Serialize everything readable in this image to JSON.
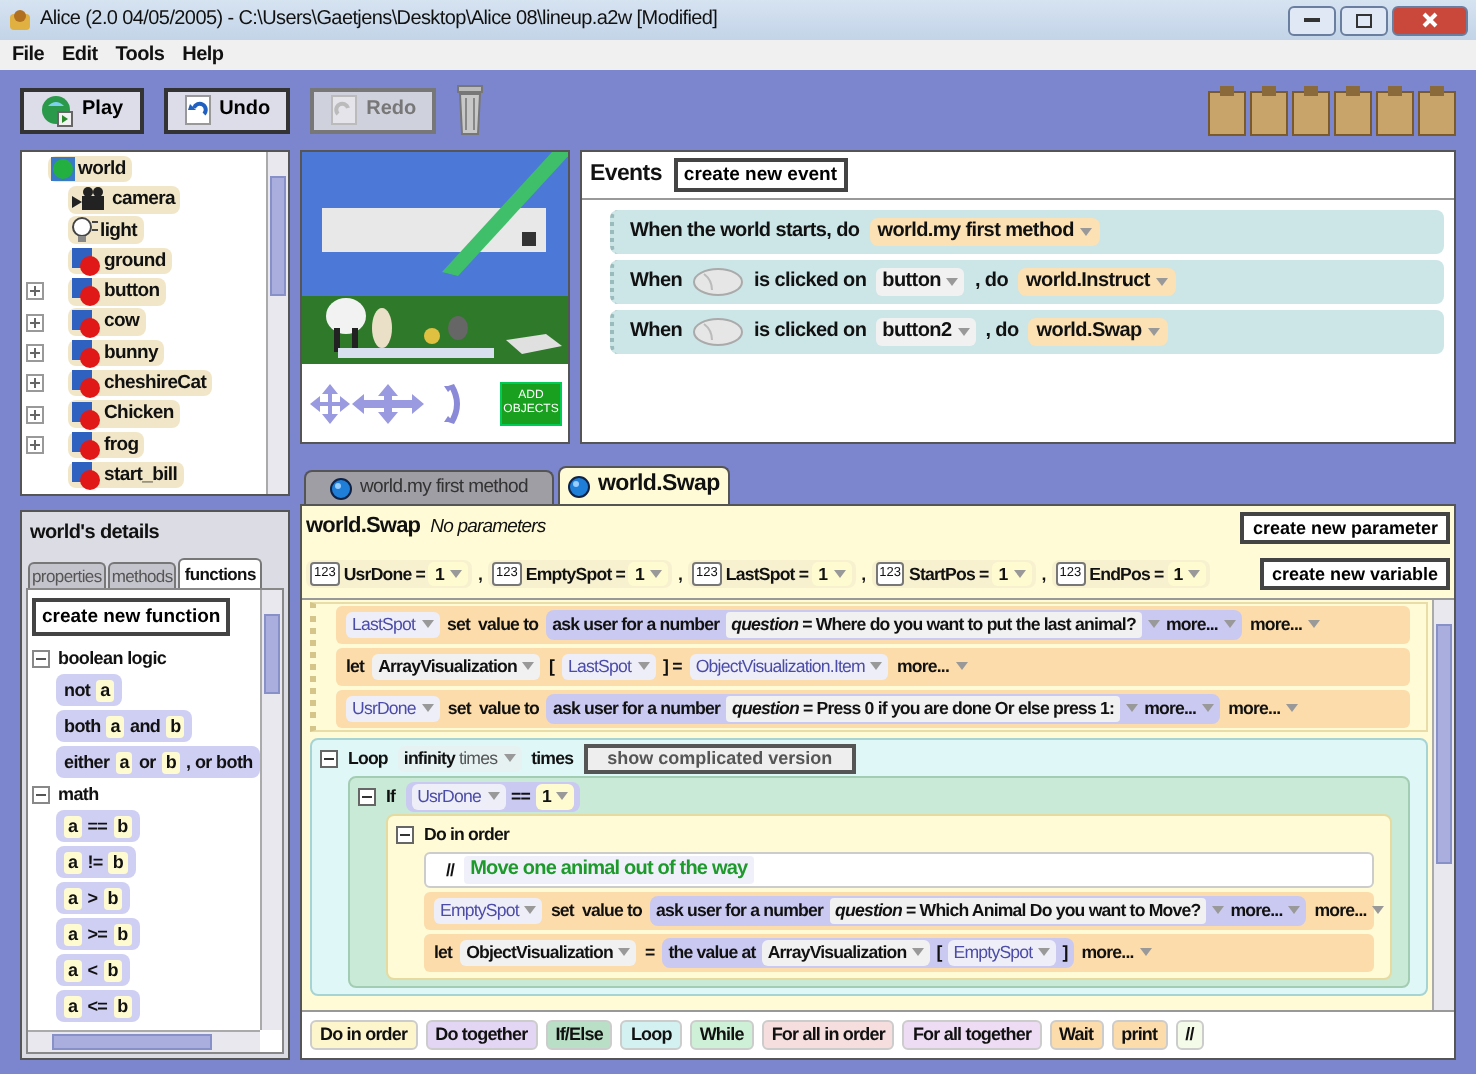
{
  "window": {
    "title": "Alice (2.0 04/05/2005) - C:\\Users\\Gaetjens\\Desktop\\Alice 08\\lineup.a2w [Modified]"
  },
  "menu": [
    "File",
    "Edit",
    "Tools",
    "Help"
  ],
  "toolbar": [
    {
      "label": "Play",
      "kind": "play",
      "disabled": false
    },
    {
      "label": "Undo",
      "kind": "undo",
      "disabled": false
    },
    {
      "label": "Redo",
      "kind": "redo",
      "disabled": true
    }
  ],
  "object_tree": {
    "root": "world",
    "items": [
      {
        "label": "camera",
        "kind": "camera",
        "expandable": false
      },
      {
        "label": "light",
        "kind": "light",
        "expandable": false
      },
      {
        "label": "ground",
        "kind": "object",
        "expandable": false
      },
      {
        "label": "button",
        "kind": "object",
        "expandable": true
      },
      {
        "label": "cow",
        "kind": "object",
        "expandable": true
      },
      {
        "label": "bunny",
        "kind": "object",
        "expandable": true
      },
      {
        "label": "cheshireCat",
        "kind": "object",
        "expandable": true
      },
      {
        "label": "Chicken",
        "kind": "object",
        "expandable": true
      },
      {
        "label": "frog",
        "kind": "object",
        "expandable": true
      },
      {
        "label": "start_bill",
        "kind": "object",
        "expandable": false
      }
    ]
  },
  "scene": {
    "kind": "picture",
    "add_button": "ADD OBJECTS"
  },
  "details": {
    "title": "world's details",
    "tabs": [
      {
        "label": "properties",
        "selected": false
      },
      {
        "label": "methods",
        "selected": false
      },
      {
        "label": "functions",
        "selected": true
      }
    ],
    "create_button": "create new function",
    "groups": [
      {
        "label": "boolean logic",
        "expanded": true,
        "tiles": [
          [
            {
              "kind": "word",
              "text": "not"
            },
            {
              "kind": "slot",
              "text": "a"
            }
          ],
          [
            {
              "kind": "word",
              "text": "both"
            },
            {
              "kind": "slot",
              "text": "a"
            },
            {
              "kind": "word",
              "text": "and"
            },
            {
              "kind": "slot",
              "text": "b"
            }
          ],
          [
            {
              "kind": "word",
              "text": "either"
            },
            {
              "kind": "slot",
              "text": "a"
            },
            {
              "kind": "word",
              "text": "or"
            },
            {
              "kind": "slot",
              "text": "b"
            },
            {
              "kind": "word",
              "text": ", or both"
            }
          ]
        ]
      },
      {
        "label": "math",
        "expanded": true,
        "tiles": [
          [
            {
              "kind": "slot",
              "text": "a"
            },
            {
              "kind": "word",
              "text": "=="
            },
            {
              "kind": "slot",
              "text": "b"
            }
          ],
          [
            {
              "kind": "slot",
              "text": "a"
            },
            {
              "kind": "word",
              "text": "!="
            },
            {
              "kind": "slot",
              "text": "b"
            }
          ],
          [
            {
              "kind": "slot",
              "text": "a"
            },
            {
              "kind": "word",
              "text": ">"
            },
            {
              "kind": "slot",
              "text": "b"
            }
          ],
          [
            {
              "kind": "slot",
              "text": "a"
            },
            {
              "kind": "word",
              "text": ">="
            },
            {
              "kind": "slot",
              "text": "b"
            }
          ],
          [
            {
              "kind": "slot",
              "text": "a"
            },
            {
              "kind": "word",
              "text": "<"
            },
            {
              "kind": "slot",
              "text": "b"
            }
          ],
          [
            {
              "kind": "slot",
              "text": "a"
            },
            {
              "kind": "word",
              "text": "<="
            },
            {
              "kind": "slot",
              "text": "b"
            }
          ]
        ]
      }
    ]
  },
  "events": {
    "title": "Events",
    "button": "create new event",
    "items": [
      {
        "parts": [
          {
            "kind": "text",
            "text": "When the world starts,  do"
          },
          {
            "kind": "method",
            "text": "world.my first method"
          }
        ]
      },
      {
        "parts": [
          {
            "kind": "text",
            "text": "When"
          },
          {
            "kind": "mouse"
          },
          {
            "kind": "text",
            "text": "is clicked on"
          },
          {
            "kind": "select",
            "text": "button"
          },
          {
            "kind": "text",
            "text": ",  do"
          },
          {
            "kind": "method",
            "text": "world.Instruct"
          }
        ]
      },
      {
        "parts": [
          {
            "kind": "text",
            "text": "When"
          },
          {
            "kind": "mouse"
          },
          {
            "kind": "text",
            "text": "is clicked on"
          },
          {
            "kind": "select",
            "text": "button2"
          },
          {
            "kind": "text",
            "text": ",  do"
          },
          {
            "kind": "method",
            "text": "world.Swap"
          }
        ]
      }
    ]
  },
  "method_tabs": [
    {
      "label": "world.my first method",
      "selected": false
    },
    {
      "label": "world.Swap",
      "selected": true
    }
  ],
  "editor": {
    "title": "world.Swap",
    "params": "No parameters",
    "param_button": "create new parameter",
    "var_button": "create new variable",
    "variables": [
      {
        "badge": "123",
        "name": "UsrDone",
        "op": "=",
        "value": "1",
        "sep": ","
      },
      {
        "badge": "123",
        "name": "EmptySpot",
        "op": "=",
        "value": "1",
        "sep": ","
      },
      {
        "badge": "123",
        "name": "LastSpot",
        "op": "=",
        "value": "1",
        "sep": ","
      },
      {
        "badge": "123",
        "name": "StartPos",
        "op": "=",
        "value": "1",
        "sep": ","
      },
      {
        "badge": "123",
        "name": "EndPos",
        "op": "=",
        "value": "1"
      }
    ],
    "blocks": [
      {
        "kind": "group",
        "children": [
          {
            "kind": "stmt",
            "parts": [
              {
                "kind": "var",
                "text": "LastSpot"
              },
              {
                "kind": "text",
                "text": "set"
              },
              {
                "kind": "text",
                "text": "value to"
              },
              {
                "kind": "call",
                "parts": [
                  {
                    "kind": "text",
                    "text": "ask user for a number"
                  },
                  {
                    "kind": "arg",
                    "text": "*question* = Where do you want to put the last animal?"
                  },
                  {
                    "kind": "more",
                    "text": "more..."
                  }
                ]
              },
              {
                "kind": "more",
                "text": "more..."
              }
            ]
          },
          {
            "kind": "stmt",
            "parts": [
              {
                "kind": "text",
                "text": "let"
              },
              {
                "kind": "select",
                "text": "ArrayVisualization"
              },
              {
                "kind": "text",
                "text": "["
              },
              {
                "kind": "var",
                "text": "LastSpot"
              },
              {
                "kind": "text",
                "text": "] ="
              },
              {
                "kind": "var",
                "text": "ObjectVisualization.Item"
              },
              {
                "kind": "more",
                "text": "more..."
              }
            ]
          },
          {
            "kind": "stmt",
            "parts": [
              {
                "kind": "var",
                "text": "UsrDone"
              },
              {
                "kind": "text",
                "text": "set"
              },
              {
                "kind": "text",
                "text": "value to"
              },
              {
                "kind": "call",
                "parts": [
                  {
                    "kind": "text",
                    "text": "ask user for a number"
                  },
                  {
                    "kind": "arg",
                    "text": "*question* = Press 0 if you are done Or else press 1:"
                  },
                  {
                    "kind": "more",
                    "text": "more..."
                  }
                ]
              },
              {
                "kind": "more",
                "text": "more..."
              }
            ]
          }
        ]
      },
      {
        "kind": "loop",
        "expanded": true,
        "header": [
          {
            "kind": "text",
            "text": "Loop"
          },
          {
            "kind": "count",
            "text": "infinity",
            "unit": "times"
          },
          {
            "kind": "text",
            "text": "times"
          },
          {
            "kind": "button",
            "text": "show complicated version"
          }
        ],
        "children": [
          {
            "kind": "if",
            "expanded": true,
            "header": [
              {
                "kind": "text",
                "text": "If"
              },
              {
                "kind": "call",
                "parts": [
                  {
                    "kind": "var",
                    "text": "UsrDone"
                  },
                  {
                    "kind": "text",
                    "text": "=="
                  },
                  {
                    "kind": "value",
                    "text": "1"
                  }
                ]
              }
            ],
            "children": [
              {
                "kind": "do_in_order",
                "expanded": true,
                "header": [
                  {
                    "kind": "text",
                    "text": "Do in order"
                  }
                ],
                "children": [
                  {
                    "kind": "comment",
                    "parts": [
                      {
                        "kind": "text",
                        "text": "//"
                      },
                      {
                        "kind": "note",
                        "text": "Move one animal out of the way"
                      }
                    ]
                  },
                  {
                    "kind": "stmt",
                    "parts": [
                      {
                        "kind": "var",
                        "text": "EmptySpot"
                      },
                      {
                        "kind": "text",
                        "text": "set"
                      },
                      {
                        "kind": "text",
                        "text": "value to"
                      },
                      {
                        "kind": "call",
                        "parts": [
                          {
                            "kind": "text",
                            "text": "ask user for a number"
                          },
                          {
                            "kind": "arg",
                            "text": "*question* = Which Animal Do you want to Move?"
                          },
                          {
                            "kind": "more",
                            "text": "more..."
                          }
                        ]
                      },
                      {
                        "kind": "more",
                        "text": "more..."
                      }
                    ]
                  },
                  {
                    "kind": "stmt",
                    "parts": [
                      {
                        "kind": "text",
                        "text": "let"
                      },
                      {
                        "kind": "select",
                        "text": "ObjectVisualization"
                      },
                      {
                        "kind": "text",
                        "text": "="
                      },
                      {
                        "kind": "call",
                        "parts": [
                          {
                            "kind": "text",
                            "text": "the value at"
                          },
                          {
                            "kind": "select",
                            "text": "ArrayVisualization"
                          },
                          {
                            "kind": "text",
                            "text": "["
                          },
                          {
                            "kind": "var",
                            "text": "EmptySpot"
                          },
                          {
                            "kind": "text",
                            "text": "]"
                          }
                        ]
                      },
                      {
                        "kind": "more",
                        "text": "more..."
                      }
                    ]
                  }
                ]
              }
            ]
          }
        ]
      }
    ],
    "palette": [
      {
        "label": "Do in order",
        "color": "#fdf6cc"
      },
      {
        "label": "Do together",
        "color": "#e2d6f4"
      },
      {
        "label": "If/Else",
        "color": "#b9dfc6"
      },
      {
        "label": "Loop",
        "color": "#d3f1f1"
      },
      {
        "label": "While",
        "color": "#cdf0d6"
      },
      {
        "label": "For all in order",
        "color": "#f6dede"
      },
      {
        "label": "For all together",
        "color": "#eedcf4"
      },
      {
        "label": "Wait",
        "color": "#fbdcaa"
      },
      {
        "label": "print",
        "color": "#fbdcaa"
      },
      {
        "label": "//",
        "color": "#f4fbe8"
      }
    ]
  }
}
